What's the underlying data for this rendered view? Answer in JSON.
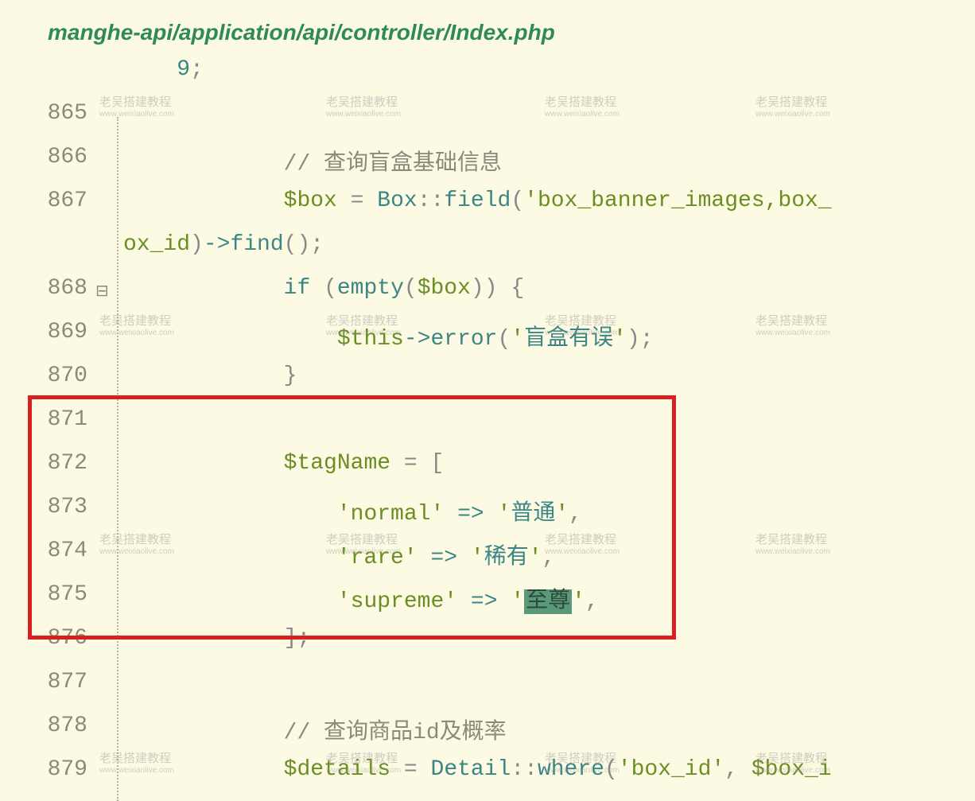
{
  "header": {
    "path": "manghe-api/application/api/controller/Index.php"
  },
  "lines": [
    {
      "num": "",
      "fold": "",
      "indent": "    ",
      "content_html": "<span class='token-number'>9</span><span class='token-punct'>;</span>"
    },
    {
      "num": "865",
      "fold": "",
      "indent": "",
      "content_html": ""
    },
    {
      "num": "866",
      "fold": "",
      "indent": "            ",
      "content_html": "<span class='token-comment'>// 查询盲盒基础信息</span>"
    },
    {
      "num": "867",
      "fold": "",
      "indent": "            ",
      "content_html": "<span class='token-variable'>$box</span> <span class='token-operator'>=</span> <span class='token-class'>Box</span><span class='token-punct'>::</span><span class='token-method'>field</span><span class='token-punct'>(</span><span class='token-string'>'box_banner_images,box_</span>"
    },
    {
      "num": "",
      "fold": "",
      "indent": "",
      "content_html": "<span class='token-variable'>ox_id</span><span class='token-punct'>)</span><span class='token-arrow'>-></span><span class='token-method'>find</span><span class='token-punct'>();</span>"
    },
    {
      "num": "868",
      "fold": "⊟",
      "indent": "            ",
      "content_html": "<span class='token-keyword'>if</span> <span class='token-punct'>(</span><span class='token-method'>empty</span><span class='token-punct'>(</span><span class='token-variable'>$box</span><span class='token-punct'>))</span> <span class='token-punct'>{</span>"
    },
    {
      "num": "869",
      "fold": "",
      "indent": "                ",
      "content_html": "<span class='token-variable'>$this</span><span class='token-arrow'>-></span><span class='token-method'>error</span><span class='token-punct'>(</span><span class='token-string'>'</span><span class='token-string-cn'>盲盒有误</span><span class='token-string'>'</span><span class='token-punct'>);</span>"
    },
    {
      "num": "870",
      "fold": "",
      "indent": "            ",
      "content_html": "<span class='token-punct'>}</span>"
    },
    {
      "num": "871",
      "fold": "",
      "indent": "",
      "content_html": ""
    },
    {
      "num": "872",
      "fold": "",
      "indent": "            ",
      "content_html": "<span class='token-variable'>$tagName</span> <span class='token-operator'>=</span> <span class='token-punct'>[</span>"
    },
    {
      "num": "873",
      "fold": "",
      "indent": "                ",
      "content_html": "<span class='token-string'>'normal'</span> <span class='token-arrow'>=></span> <span class='token-string'>'</span><span class='token-string-cn'>普通</span><span class='token-string'>'</span><span class='token-punct'>,</span>"
    },
    {
      "num": "874",
      "fold": "",
      "indent": "                ",
      "content_html": "<span class='token-string'>'rare'</span> <span class='token-arrow'>=></span> <span class='token-string'>'</span><span class='token-string-cn'>稀有</span><span class='token-string'>'</span><span class='token-punct'>,</span>"
    },
    {
      "num": "875",
      "fold": "",
      "indent": "                ",
      "content_html": "<span class='token-string'>'supreme'</span> <span class='token-arrow'>=></span> <span class='token-string'>'</span><span class='highlighted'>至尊</span><span class='token-string'>'</span><span class='token-punct'>,</span>"
    },
    {
      "num": "876",
      "fold": "",
      "indent": "            ",
      "content_html": "<span class='token-punct'>];</span>"
    },
    {
      "num": "877",
      "fold": "",
      "indent": "",
      "content_html": ""
    },
    {
      "num": "878",
      "fold": "",
      "indent": "            ",
      "content_html": "<span class='token-comment'>// 查询商品id及概率</span>"
    },
    {
      "num": "879",
      "fold": "",
      "indent": "            ",
      "content_html": "<span class='token-variable'>$det</span><span class='token-variable'>ails</span> <span class='token-operator'>=</span> <span class='token-class'>Detail</span><span class='token-punct'>::</span><span class='token-method'>where</span><span class='token-punct'>(</span><span class='token-string'>'box_id'</span><span class='token-punct'>,</span> <span class='token-variable'>$box_i</span>"
    }
  ],
  "fold_symbol": "⊟",
  "watermark": {
    "main": "老吴搭建教程",
    "sub": "www.weixiaolive.com"
  }
}
